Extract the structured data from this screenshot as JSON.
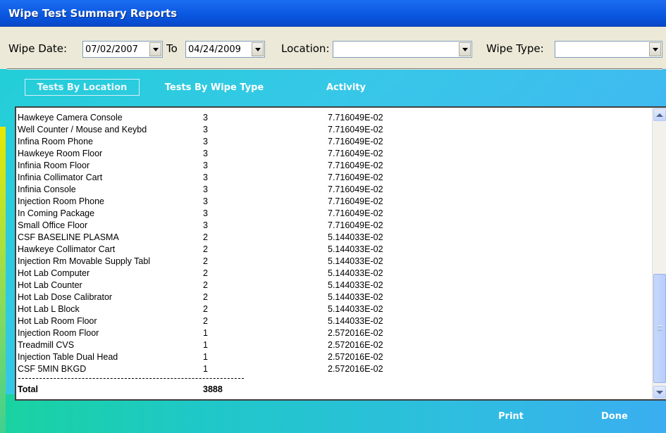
{
  "window": {
    "title": "Wipe Test Summary Reports"
  },
  "filters": {
    "wipe_date_label": "Wipe Date:",
    "wipe_date_from": "07/02/2007",
    "to_label": "To",
    "wipe_date_to": "04/24/2009",
    "location_label": "Location:",
    "location_value": "",
    "wipe_type_label": "Wipe Type:",
    "wipe_type_value": ""
  },
  "tabs": {
    "by_location": "Tests By Location",
    "by_wipe_type": "Tests By Wipe Type",
    "activity": "Activity"
  },
  "report": {
    "rows": [
      {
        "location": "Hawkeye Camera Console",
        "tests": "3",
        "activity": "7.716049E-02"
      },
      {
        "location": "Well Counter / Mouse and Keybd",
        "tests": "3",
        "activity": "7.716049E-02"
      },
      {
        "location": "Infina Room Phone",
        "tests": "3",
        "activity": "7.716049E-02"
      },
      {
        "location": "Hawkeye Room Floor",
        "tests": "3",
        "activity": "7.716049E-02"
      },
      {
        "location": "Infinia Room Floor",
        "tests": "3",
        "activity": "7.716049E-02"
      },
      {
        "location": "Infinia Collimator Cart",
        "tests": "3",
        "activity": "7.716049E-02"
      },
      {
        "location": "Infinia Console",
        "tests": "3",
        "activity": "7.716049E-02"
      },
      {
        "location": "Injection Room Phone",
        "tests": "3",
        "activity": "7.716049E-02"
      },
      {
        "location": "In Coming Package",
        "tests": "3",
        "activity": "7.716049E-02"
      },
      {
        "location": "Small Office Floor",
        "tests": "3",
        "activity": "7.716049E-02"
      },
      {
        "location": "CSF BASELINE PLASMA",
        "tests": "2",
        "activity": "5.144033E-02"
      },
      {
        "location": "Hawkeye Collimator Cart",
        "tests": "2",
        "activity": "5.144033E-02"
      },
      {
        "location": "Injection Rm Movable Supply Tabl",
        "tests": "2",
        "activity": "5.144033E-02"
      },
      {
        "location": "Hot Lab Computer",
        "tests": "2",
        "activity": "5.144033E-02"
      },
      {
        "location": "Hot Lab Counter",
        "tests": "2",
        "activity": "5.144033E-02"
      },
      {
        "location": "Hot Lab Dose Calibrator",
        "tests": "2",
        "activity": "5.144033E-02"
      },
      {
        "location": "Hot Lab L Block",
        "tests": "2",
        "activity": "5.144033E-02"
      },
      {
        "location": "Hot Lab Room Floor",
        "tests": "2",
        "activity": "5.144033E-02"
      },
      {
        "location": "Injection Room Floor",
        "tests": "1",
        "activity": "2.572016E-02"
      },
      {
        "location": "Treadmill CVS",
        "tests": "1",
        "activity": "2.572016E-02"
      },
      {
        "location": "Injection Table Dual Head",
        "tests": "1",
        "activity": "2.572016E-02"
      },
      {
        "location": "CSF 5MIN BKGD",
        "tests": "1",
        "activity": "2.572016E-02"
      }
    ],
    "total_label": "Total",
    "total_value": "3888"
  },
  "actions": {
    "print": "Print",
    "done": "Done"
  }
}
